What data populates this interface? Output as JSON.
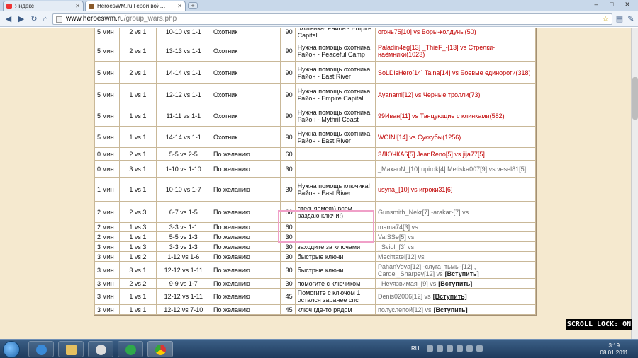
{
  "browser": {
    "tabs": [
      {
        "label": "Яндекс",
        "active": false
      },
      {
        "label": "HeroesWM.ru Герои вой…",
        "active": true
      }
    ],
    "url_host": "www.heroeswm.ru",
    "url_path": "/group_wars.php"
  },
  "rows": [
    {
      "time": "5 мин",
      "mode": "2 vs 1",
      "lvl": "10-10 vs 1-1",
      "type": "Охотник",
      "num": "90",
      "cmt": "охотника! Район - Empire Capital",
      "part": "огонь75[10] vs Воры-колдуны(50)"
    },
    {
      "time": "5 мин",
      "mode": "2 vs 1",
      "lvl": "13-13 vs 1-1",
      "type": "Охотник",
      "num": "90",
      "cmt": "Нужна помощь охотника! Район - Peaceful Camp",
      "part": "Paladin4eg[13] _ThieF_-[13] vs Стрелки-наёмники(1023)"
    },
    {
      "time": "5 мин",
      "mode": "2 vs 1",
      "lvl": "14-14 vs 1-1",
      "type": "Охотник",
      "num": "90",
      "cmt": "Нужна помощь охотника! Район - East River",
      "part": "SoLDisHero[14] Taina[14] vs Боевые единороги(318)"
    },
    {
      "time": "5 мин",
      "mode": "1 vs 1",
      "lvl": "12-12 vs 1-1",
      "type": "Охотник",
      "num": "90",
      "cmt": "Нужна помощь охотника! Район - Empire Capital",
      "part": "Ayanami[12] vs Черные тролли(73)"
    },
    {
      "time": "5 мин",
      "mode": "1 vs 1",
      "lvl": "11-11 vs 1-1",
      "type": "Охотник",
      "num": "90",
      "cmt": "Нужна помощь охотника! Район - Mythril Coast",
      "part": "99Иван[11] vs Танцующие с клинками(582)"
    },
    {
      "time": "5 мин",
      "mode": "1 vs 1",
      "lvl": "14-14 vs 1-1",
      "type": "Охотник",
      "num": "90",
      "cmt": "Нужна помощь охотника! Район - East River",
      "part": "WOINI[14] vs Суккубы(1256)"
    },
    {
      "time": "0 мин",
      "mode": "2 vs 1",
      "lvl": "5-5 vs 2-5",
      "type": "По желанию",
      "num": "60",
      "cmt": "",
      "part": "ЗЛЮЧКА6[5] JeanReno[5] vs jija77[5]"
    },
    {
      "time": "0 мин",
      "mode": "3 vs 1",
      "lvl": "1-10 vs 1-10",
      "type": "По желанию",
      "num": "30",
      "cmt": "",
      "part": "_MaxaoN_[10] upirok[4] Metiska007[9] vs vesel81[5]"
    },
    {
      "time": "1 мин",
      "mode": "1 vs 1",
      "lvl": "10-10 vs 1-7",
      "type": "По желанию",
      "num": "30",
      "cmt": "Нужна помощь ключика! Район - East River",
      "part": "usyna_[10] vs игроки31[6]"
    },
    {
      "time": "2 мин",
      "mode": "2 vs 3",
      "lvl": "6-7 vs 1-5",
      "type": "По желанию",
      "num": "60",
      "cmt": "стесняемся)) всем раздаю ключи!)",
      "part": "Gunsmith_Nekr[7] -arakar-[7] vs"
    },
    {
      "time": "2 мин",
      "mode": "1 vs 3",
      "lvl": "3-3 vs 1-1",
      "type": "По желанию",
      "num": "60",
      "cmt": "",
      "part": "mama74[3] vs"
    },
    {
      "time": "2 мин",
      "mode": "1 vs 1",
      "lvl": "5-5 vs 1-3",
      "type": "По желанию",
      "num": "30",
      "cmt": "",
      "part": "VaISSe[5] vs"
    },
    {
      "time": "3 мин",
      "mode": "1 vs 3",
      "lvl": "3-3 vs 1-3",
      "type": "По желанию",
      "num": "30",
      "cmt": "заходите за ключами",
      "part": "_Sviol_[3] vs"
    },
    {
      "time": "3 мин",
      "mode": "1 vs 2",
      "lvl": "1-12 vs 1-6",
      "type": "По желанию",
      "num": "30",
      "cmt": "быстрые ключи",
      "part": "Mechtatel[12] vs"
    },
    {
      "time": "3 мин",
      "mode": "3 vs 1",
      "lvl": "12-12 vs 1-11",
      "type": "По желанию",
      "num": "30",
      "cmt": "быстрые ключи",
      "part": "PahanVova[12] -слуга_тьмы-[12] , Cardel_Sharpey[12] vs"
    },
    {
      "time": "3 мин",
      "mode": "2 vs 2",
      "lvl": "9-9 vs 1-7",
      "type": "По желанию",
      "num": "30",
      "cmt": "помогите с ключиком",
      "part": "_Неуязвимая_[9] vs"
    },
    {
      "time": "3 мин",
      "mode": "1 vs 1",
      "lvl": "12-12 vs 1-11",
      "type": "По желанию",
      "num": "45",
      "cmt": "Помогите с ключом 1 остался заранее спс",
      "part": "Denis02006[12] vs"
    },
    {
      "time": "3 мин",
      "mode": "1 vs 1",
      "lvl": "12-12 vs 7-10",
      "type": "По желанию",
      "num": "45",
      "cmt": "ключ где-то рядом",
      "part": "полуслепой[12] vs"
    }
  ],
  "join_label": "[Вступить]",
  "row9_overlay": "сонду...",
  "scroll_lock": "SCROLL LOCK: ON",
  "taskbar": {
    "lang": "RU",
    "time": "3:19",
    "date": "08.01.2011"
  }
}
